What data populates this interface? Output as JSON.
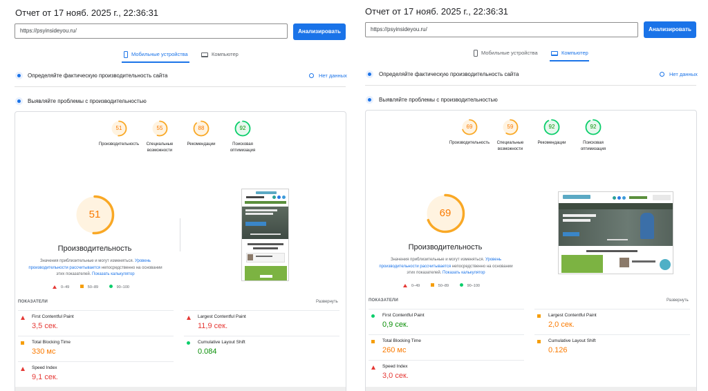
{
  "colors": {
    "red": "#e53935",
    "orange": "#fa7a00",
    "orange_ring": "#f9a825",
    "green": "#0a8f08",
    "green_ring": "#0cce6b",
    "blue": "#1a73e8"
  },
  "left": {
    "report_title": "Отчет от 17 нояб. 2025 г., 22:36:31",
    "url_value": "https://psyinsideyou.ru/",
    "analyze_label": "Анализировать",
    "tabs": [
      {
        "label": "Мобильные устройства",
        "icon": "phone-icon",
        "active": true
      },
      {
        "label": "Компьютер",
        "icon": "laptop-icon",
        "active": false
      }
    ],
    "section1": "Определяйте фактическую производительность сайта",
    "no_data": "Нет данных",
    "section2": "Выявляйте проблемы с производительностью",
    "scores": [
      {
        "value": "51",
        "label": "Производительность",
        "status": "orange",
        "fraction": 0.51
      },
      {
        "value": "55",
        "label": "Специальные возможности",
        "status": "orange",
        "fraction": 0.55
      },
      {
        "value": "88",
        "label": "Рекомендации",
        "status": "orange",
        "fraction": 0.88
      },
      {
        "value": "92",
        "label": "Поисковая оптимизация",
        "status": "green",
        "fraction": 0.92
      }
    ],
    "big_score": "51",
    "big_fraction": 0.51,
    "big_title": "Производительность",
    "note_1": "Значения приблизительные и могут изменяться.",
    "note_link_1": "Уровень производительности рассчитывается",
    "note_2": "непосредственно на основании этих показателей.",
    "note_link_2": "Показать калькулятор",
    "legend": {
      "red": "0–49",
      "orange": "50–89",
      "green": "90–100"
    },
    "metrics_header": "ПОКАЗАТЕЛИ",
    "expand_label": "Развернуть",
    "metrics": [
      {
        "name": "First Contentful Paint",
        "value": "3,5 сек.",
        "status": "red"
      },
      {
        "name": "Largest Contentful Paint",
        "value": "11,9 сек.",
        "status": "red"
      },
      {
        "name": "Total Blocking Time",
        "value": "330 мс",
        "status": "orange"
      },
      {
        "name": "Cumulative Layout Shift",
        "value": "0.084",
        "status": "green"
      },
      {
        "name": "Speed Index",
        "value": "9,1 сек.",
        "status": "red"
      }
    ]
  },
  "right": {
    "report_title": "Отчет от 17 нояб. 2025 г., 22:36:31",
    "url_value": "https://psyinsideyou.ru/",
    "analyze_label": "Анализировать",
    "tabs": [
      {
        "label": "Мобильные устройства",
        "icon": "phone-icon",
        "active": false
      },
      {
        "label": "Компьютер",
        "icon": "laptop-icon",
        "active": true
      }
    ],
    "section1": "Определяйте фактическую производительность сайта",
    "no_data": "Нет данных",
    "section2": "Выявляйте проблемы с производительностью",
    "scores": [
      {
        "value": "69",
        "label": "Производительность",
        "status": "orange",
        "fraction": 0.69
      },
      {
        "value": "59",
        "label": "Специальные возможности",
        "status": "orange",
        "fraction": 0.59
      },
      {
        "value": "92",
        "label": "Рекомендации",
        "status": "green",
        "fraction": 0.92
      },
      {
        "value": "92",
        "label": "Поисковая оптимизация",
        "status": "green",
        "fraction": 0.92
      }
    ],
    "big_score": "69",
    "big_fraction": 0.69,
    "big_title": "Производительность",
    "note_1": "Значения приблизительные и могут изменяться.",
    "note_link_1": "Уровень производительности рассчитывается",
    "note_2": "непосредственно на основании этих показателей.",
    "note_link_2": "Показать калькулятор",
    "legend": {
      "red": "0–49",
      "orange": "50–89",
      "green": "90–100"
    },
    "metrics_header": "ПОКАЗАТЕЛИ",
    "expand_label": "Развернуть",
    "metrics": [
      {
        "name": "First Contentful Paint",
        "value": "0,9 сек.",
        "status": "green"
      },
      {
        "name": "Largest Contentful Paint",
        "value": "2,0 сек.",
        "status": "orange"
      },
      {
        "name": "Total Blocking Time",
        "value": "260 мс",
        "status": "orange"
      },
      {
        "name": "Cumulative Layout Shift",
        "value": "0.126",
        "status": "orange"
      },
      {
        "name": "Speed Index",
        "value": "3,0 сек.",
        "status": "red"
      }
    ]
  }
}
